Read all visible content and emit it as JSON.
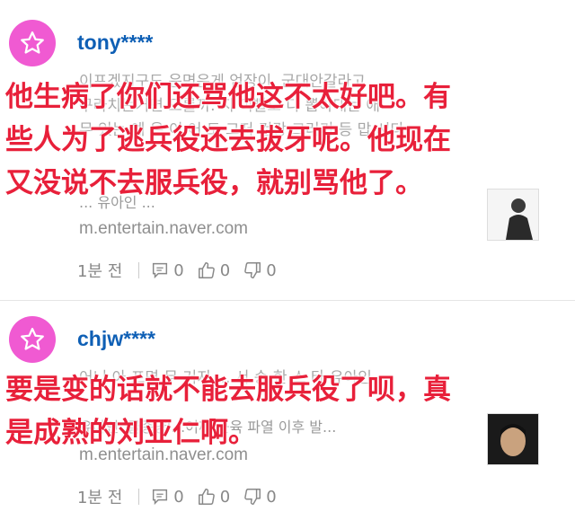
{
  "comments": [
    {
      "username": "tony****",
      "body_lines": [
        "이프겠지구도 운면은게 엄장이, 군대안갈라고",
        "구라치는거면 모를까. 지 이빨도 다 뽑아대는 애",
        "무 있는 예 온 이 어 도 그저 건강 그러기 등 맙 시다"
      ],
      "link_title": "... 유아인 ...",
      "source": "m.entertain.naver.com",
      "time": "1분 전",
      "reply_count": "0",
      "like_count": "0",
      "dislike_count": "0",
      "overlay_lines": [
        "他生病了你们还骂他这不太好吧。有",
        "些人为了逃兵役还去拔牙呢。他现在",
        "又没说不去服兵役，就别骂他了。"
      ]
    },
    {
      "username": "chjw****",
      "body_lines": [
        "어니 아 프면 무 거지 ... 서 송 한 스 타 유아인"
      ],
      "link_title": "유아인 '골종양'…어깨 근육 파열 이후 발...",
      "source": "m.entertain.naver.com",
      "time": "1분 전",
      "reply_count": "0",
      "like_count": "0",
      "dislike_count": "0",
      "overlay_lines": [
        "要是变的话就不能去服兵役了呗，真",
        "是成熟的刘亚仁啊。"
      ]
    }
  ],
  "icons": {
    "avatar": "star-icon",
    "reply": "reply-icon",
    "like": "thumbs-up-icon",
    "dislike": "thumbs-down-icon"
  },
  "colors": {
    "avatar_bg": "#f05ad2",
    "username": "#0e5fb5",
    "overlay_text": "#e8203a"
  }
}
